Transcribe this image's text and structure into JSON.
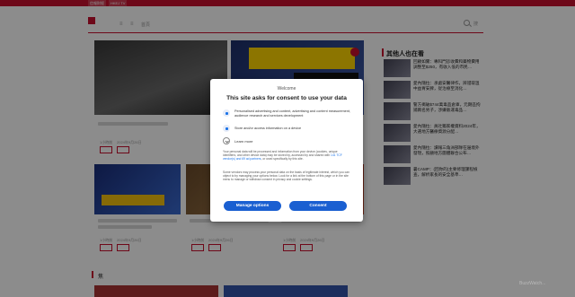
{
  "topbar": {
    "items": [
      "信報財經",
      "HKEJ TV",
      "",
      ""
    ]
  },
  "header": {
    "nav_icon_1": "≡",
    "nav_icon_2": "≡",
    "nav_text": "首頁",
    "search_label": "搜"
  },
  "cards": [
    {
      "meta": "1小時前",
      "date": "2024年9月26日",
      "tags": [
        "",
        ""
      ]
    },
    {
      "meta": "1小時前",
      "date": "2024年9月26日",
      "tags": [
        "",
        ""
      ]
    },
    {
      "meta": "1小時前",
      "date": "2024年9月26日",
      "tags": [
        "",
        ""
      ]
    },
    {
      "meta": "1小時前",
      "date": "2024年9月26日",
      "tags": [
        "",
        ""
      ]
    }
  ],
  "section": {
    "title": "焦"
  },
  "sidebar": {
    "title": "其他人也在看",
    "items": [
      {
        "text": "回顧如實：專科門診收費和藥物費用調整至$250，有收入低的市民…",
        "time": ""
      },
      {
        "text": "愛內隨拉：承處安醫律作，辨證取溫中益胃安脾，從治療至消化…",
        "time": ""
      },
      {
        "text": "警方搗破$744萬毒品倉庫，元朗區拘捕兩名男子，涉嫌販運毒品…",
        "time": ""
      },
      {
        "text": "愛內隨拉：員社獨家權資料2024年，大選地方醫療資源分配…",
        "time": ""
      },
      {
        "text": "愛內隨拉：讀報三角洲部隊在邊境外發現，照顧地方團體聯合公布…",
        "time": ""
      },
      {
        "text": "暑CAMP：(回你的)主要修理課程檢查，解析家長的安全基準…",
        "time": ""
      }
    ]
  },
  "consent": {
    "welcome": "Welcome",
    "title": "This site asks for consent to use your data",
    "purposes": [
      "Personalised advertising and content, advertising and content measurement, audience research and services development",
      "Store and/or access information on a device"
    ],
    "learn_more": "Learn more",
    "body1_a": "Your personal data will be processed and information from your device (cookies, unique identifiers, and other device data) may be stored by, accessed by and shared with ",
    "body1_link": "141 TCF vendor(s) and 69 ad partners",
    "body1_b": ", or used specifically by this site.",
    "body2": "Some vendors may process your personal data on the basis of legitimate interest, which you can object to by managing your options below. Look for a link at the bottom of this page or in the site menu to manage or withdraw consent in privacy and cookie settings.",
    "manage_label": "Manage options",
    "consent_label": "Consent"
  },
  "watermark": "BuzzWatch...",
  "colors": {
    "brand": "#c8102e",
    "button": "#1a5fd1",
    "link": "#1a73e8"
  }
}
